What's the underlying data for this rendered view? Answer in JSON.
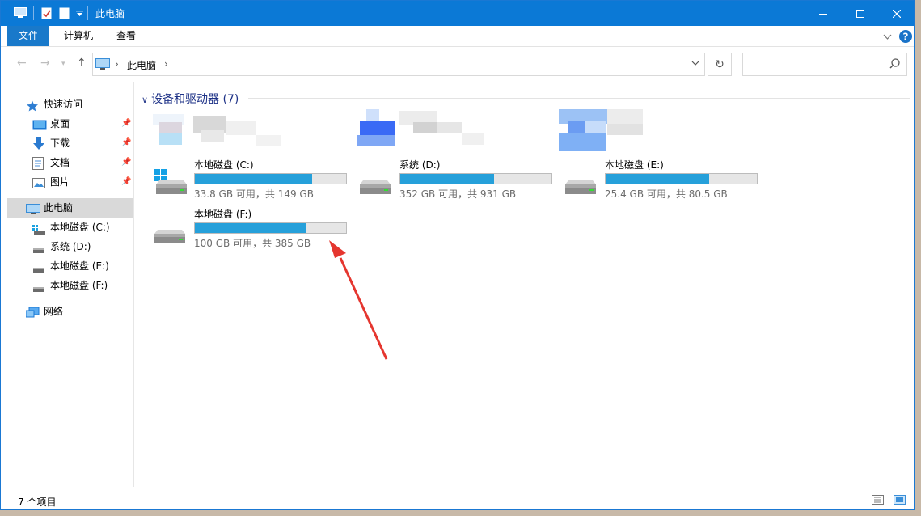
{
  "window": {
    "title": "此电脑"
  },
  "ribbon": {
    "tabs": [
      "文件",
      "计算机",
      "查看"
    ]
  },
  "address": {
    "crumb": "此电脑",
    "search_placeholder": ""
  },
  "nav": {
    "quick_access": "快速访问",
    "quick_items": [
      {
        "label": "桌面",
        "icon": "desktop-icon"
      },
      {
        "label": "下载",
        "icon": "download-icon"
      },
      {
        "label": "文档",
        "icon": "documents-icon"
      },
      {
        "label": "图片",
        "icon": "pictures-icon"
      }
    ],
    "this_pc": "此电脑",
    "drives": [
      "本地磁盘 (C:)",
      "系统 (D:)",
      "本地磁盘 (E:)",
      "本地磁盘 (F:)"
    ],
    "network": "网络"
  },
  "main": {
    "group_header": "设备和驱动器 (7)",
    "drives": [
      {
        "name": "本地磁盘 (C:)",
        "info": "33.8 GB 可用，共 149 GB",
        "used_fraction": 0.773,
        "icon": "windows-drive-icon"
      },
      {
        "name": "系统 (D:)",
        "info": "352 GB 可用，共 931 GB",
        "used_fraction": 0.622,
        "icon": "hard-drive-icon"
      },
      {
        "name": "本地磁盘 (E:)",
        "info": "25.4 GB 可用，共 80.5 GB",
        "used_fraction": 0.684,
        "icon": "hard-drive-icon"
      },
      {
        "name": "本地磁盘 (F:)",
        "info": "100 GB 可用，共 385 GB",
        "used_fraction": 0.74,
        "icon": "hard-drive-icon"
      }
    ]
  },
  "status": {
    "count": "7 个项目"
  },
  "colors": {
    "accent": "#0b79d6",
    "bar": "#26a0da",
    "arrow": "#e5362f"
  }
}
